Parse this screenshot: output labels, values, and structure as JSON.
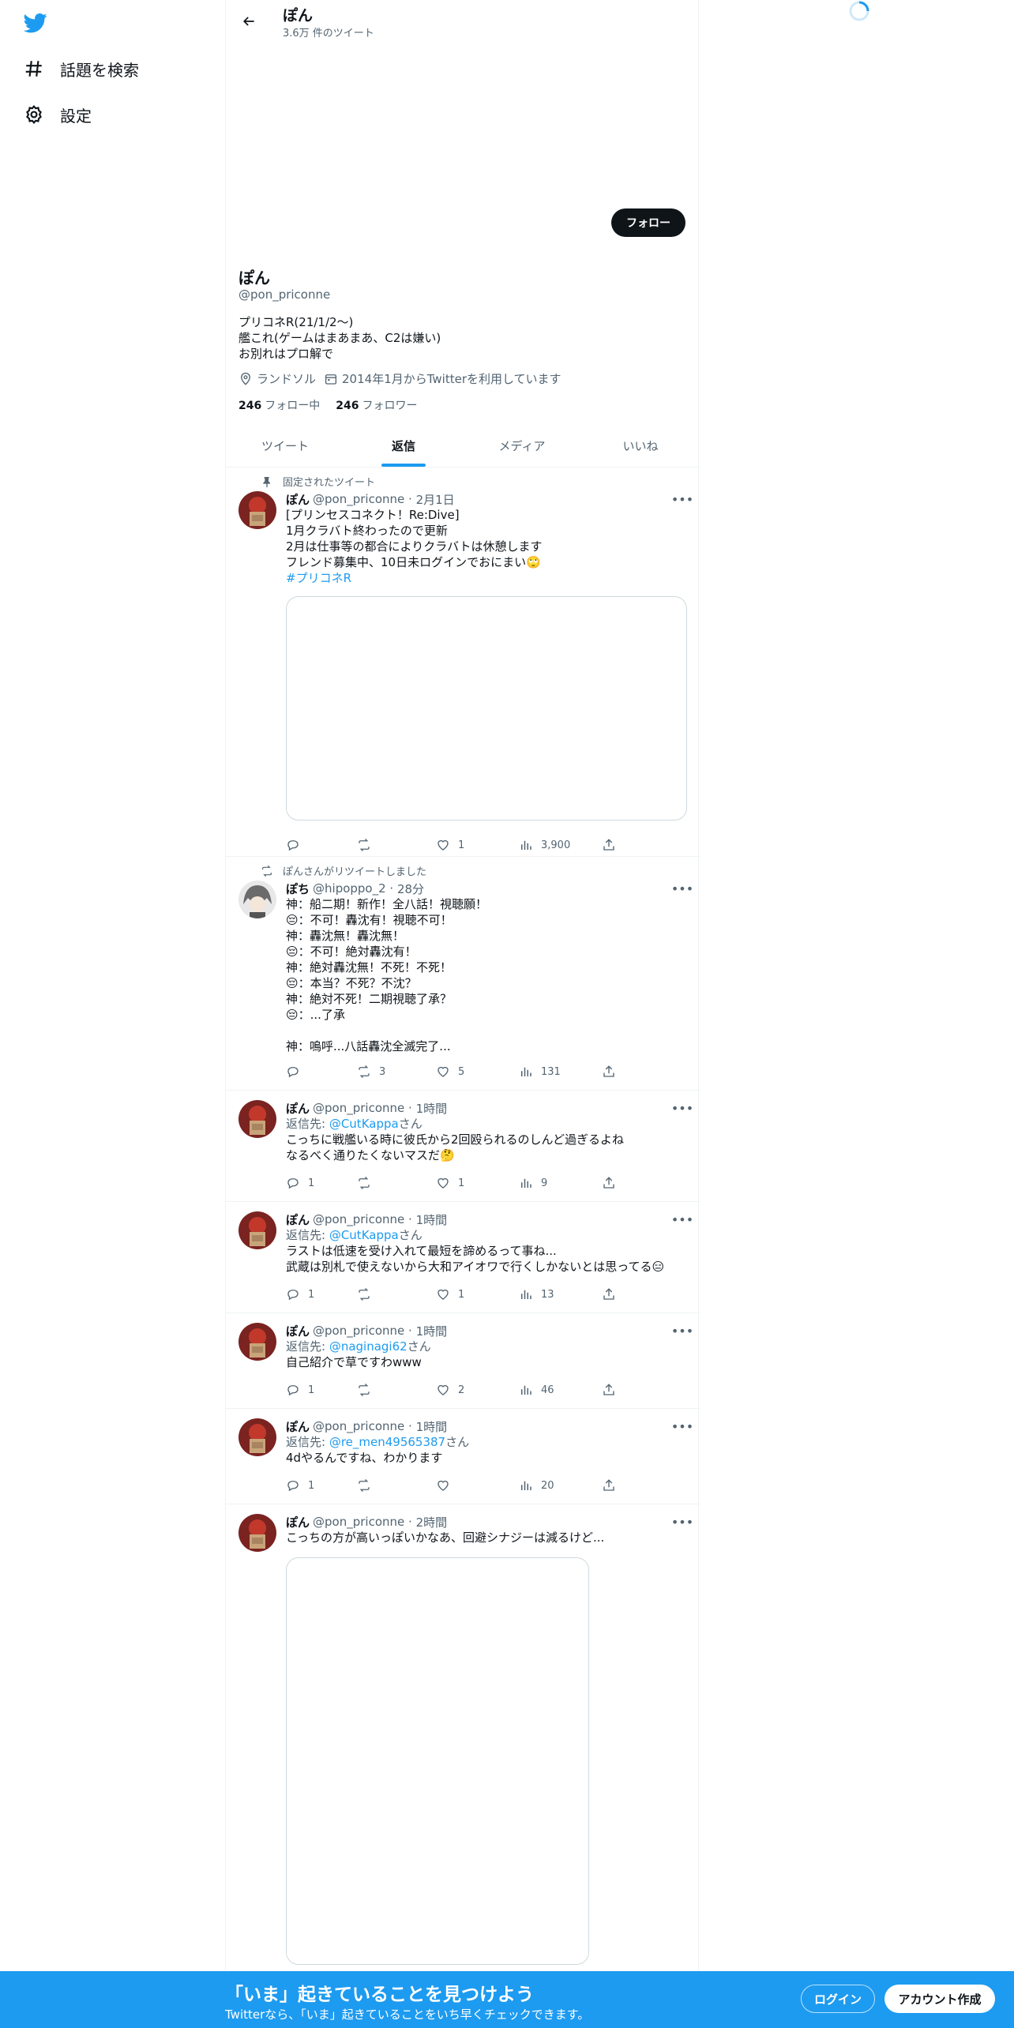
{
  "nav": {
    "explore_label": "話題を検索",
    "settings_label": "設定"
  },
  "header": {
    "name": "ぽん",
    "tweet_count": "3.6万 件のツイート"
  },
  "profile": {
    "follow_label": "フォロー",
    "name": "ぽん",
    "handle": "@pon_priconne",
    "bio": "プリコネR(21/1/2～)\n艦これ(ゲームはまあまあ、C2は嫌い)\nお別れはプロ解で",
    "location": "ランドソル",
    "joined": "2014年1月からTwitterを利用しています",
    "following_count": "246",
    "following_label": "フォロー中",
    "followers_count": "246",
    "followers_label": "フォロワー"
  },
  "tabs": [
    {
      "label": "ツイート"
    },
    {
      "label": "返信"
    },
    {
      "label": "メディア"
    },
    {
      "label": "いいね"
    }
  ],
  "tweets": [
    {
      "context": "固定されたツイート",
      "name": "ぽん",
      "handle": "@pon_priconne",
      "time": "2月1日",
      "text": "[プリンセスコネクト！Re:Dive]\n1月クラバト終わったので更新\n2月は仕事等の都合によりクラバトは休憩します\nフレンド募集中、10日未ログインでおにまい🙄",
      "hashtag": "#プリコネR",
      "replies": "",
      "retweets": "",
      "likes": "1",
      "views": "3,900"
    },
    {
      "context": "ぽんさんがリツイートしました",
      "name": "ぽち",
      "handle": "@hipoppo_2",
      "time": "28分",
      "text": "神：船二期！新作！全八話！視聴願！\n😔：不可！轟沈有！視聴不可！\n神：轟沈無！轟沈無！\n😔：不可！絶対轟沈有！\n神：絶対轟沈無！不死！不死！\n😔：本当？不死？不沈？\n神：絶対不死！二期視聴了承？\n😔：...了承\n\n神：嗚呼...八話轟沈全滅完了...",
      "replies": "",
      "retweets": "3",
      "likes": "5",
      "views": "131"
    },
    {
      "name": "ぽん",
      "handle": "@pon_priconne",
      "time": "1時間",
      "reply_prefix": "返信先: ",
      "reply_to": "@CutKappa",
      "reply_suffix": "さん",
      "text": "こっちに戦艦いる時に彼氏から2回殴られるのしんど過ぎるよね\nなるべく通りたくないマスだ🤔",
      "replies": "1",
      "retweets": "",
      "likes": "1",
      "views": "9"
    },
    {
      "name": "ぽん",
      "handle": "@pon_priconne",
      "time": "1時間",
      "reply_prefix": "返信先: ",
      "reply_to": "@CutKappa",
      "reply_suffix": "さん",
      "text": "ラストは低速を受け入れて最短を諦めるって事ね...\n武蔵は別札で使えないから大和アイオワで行くしかないとは思ってる😑",
      "replies": "1",
      "retweets": "",
      "likes": "1",
      "views": "13"
    },
    {
      "name": "ぽん",
      "handle": "@pon_priconne",
      "time": "1時間",
      "reply_prefix": "返信先: ",
      "reply_to": "@naginagi62",
      "reply_suffix": "さん",
      "text": "自己紹介で草ですわwww",
      "replies": "1",
      "retweets": "",
      "likes": "2",
      "views": "46"
    },
    {
      "name": "ぽん",
      "handle": "@pon_priconne",
      "time": "1時間",
      "reply_prefix": "返信先: ",
      "reply_to": "@re_men49565387",
      "reply_suffix": "さん",
      "text": "4dやるんですね、わかります",
      "replies": "1",
      "retweets": "",
      "likes": "",
      "views": "20"
    },
    {
      "name": "ぽん",
      "handle": "@pon_priconne",
      "time": "2時間",
      "text": "こっちの方が高いっぽいかなあ、回避シナジーは減るけど..."
    }
  ],
  "bottom": {
    "title": "「いま」起きていることを見つけよう",
    "subtitle": "Twitterなら、「いま」起きていることをいち早くチェックできます。",
    "login_label": "ログイン",
    "signup_label": "アカウント作成"
  },
  "colors": {
    "brand": "#1d9bf0",
    "text": "#0f1419",
    "secondary": "#536471"
  }
}
